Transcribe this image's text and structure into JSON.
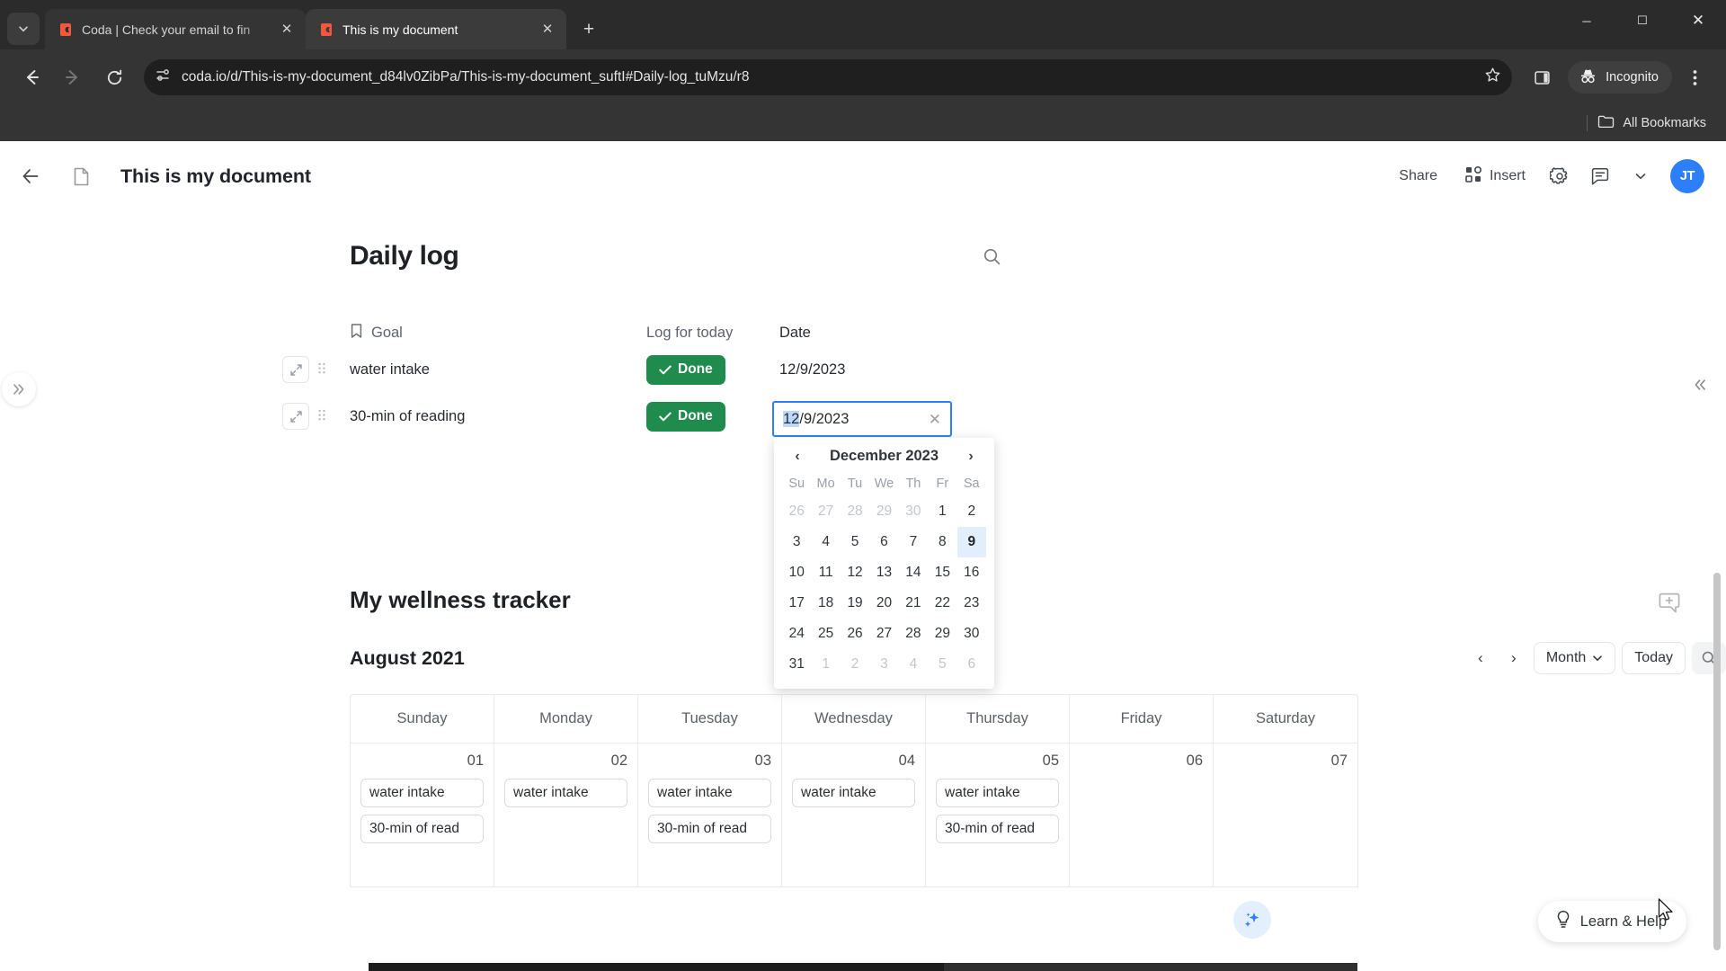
{
  "browser": {
    "tabs": [
      {
        "title": "Coda | Check your email to fin",
        "favicon": "coda-icon",
        "active": false
      },
      {
        "title": "This is my document",
        "favicon": "coda-icon",
        "active": true
      }
    ],
    "new_tab_label": "+",
    "tab_list_icon": "chevron-down-icon",
    "window_controls": {
      "minimize": "─",
      "maximize": "☐",
      "close": "✕"
    },
    "nav": {
      "back": "back-arrow-icon",
      "forward": "forward-arrow-icon",
      "reload": "reload-icon"
    },
    "omnibox": {
      "site_info_icon": "page-info-icon",
      "url": "coda.io/d/This-is-my-document_d84lv0ZibPa/This-is-my-document_suftI#Daily-log_tuMzu/r8",
      "bookmark_icon": "star-icon"
    },
    "side_panel_icon": "side-panel-icon",
    "incognito_label": "Incognito",
    "menu_icon": "three-dot-menu-icon",
    "bookmarks": {
      "all_bookmarks_label": "All Bookmarks"
    }
  },
  "doc": {
    "back_icon": "back-arrow-icon",
    "doc_icon": "document-icon",
    "title": "This is my document",
    "actions": {
      "share": "Share",
      "insert": "Insert",
      "settings_icon": "gear-icon",
      "comments_icon": "comment-icon",
      "chevron_icon": "chevron-down-icon"
    },
    "avatar_initials": "JT",
    "expand_left_icon": "double-chevron-right-icon",
    "collapse_right_icon": "double-chevron-left-icon",
    "add_comment_icon": "add-comment-icon"
  },
  "daily_log": {
    "title": "Daily log",
    "search_icon": "search-icon",
    "columns": [
      "Goal",
      "Log for today",
      "Date"
    ],
    "goal_column_icon": "bookmark-icon",
    "rows": [
      {
        "goal": "water intake",
        "log": "Done",
        "date": "12/9/2023",
        "editing": false
      },
      {
        "goal": "30-min of reading",
        "log": "Done",
        "date": "12/9/2023",
        "editing": true
      }
    ],
    "done_color": "#1f8c4d",
    "editor": {
      "value_selected": "12",
      "value_rest": "/9/2023",
      "clear_icon": "close-icon"
    }
  },
  "datepicker": {
    "prev_icon": "‹",
    "next_icon": "›",
    "month_label": "December 2023",
    "dow": [
      "Su",
      "Mo",
      "Tu",
      "We",
      "Th",
      "Fr",
      "Sa"
    ],
    "weeks": [
      [
        {
          "d": "26",
          "muted": true
        },
        {
          "d": "27",
          "muted": true
        },
        {
          "d": "28",
          "muted": true
        },
        {
          "d": "29",
          "muted": true
        },
        {
          "d": "30",
          "muted": true
        },
        {
          "d": "1"
        },
        {
          "d": "2"
        }
      ],
      [
        {
          "d": "3"
        },
        {
          "d": "4"
        },
        {
          "d": "5"
        },
        {
          "d": "6"
        },
        {
          "d": "7"
        },
        {
          "d": "8"
        },
        {
          "d": "9",
          "selected": true
        }
      ],
      [
        {
          "d": "10"
        },
        {
          "d": "11"
        },
        {
          "d": "12"
        },
        {
          "d": "13"
        },
        {
          "d": "14"
        },
        {
          "d": "15"
        },
        {
          "d": "16"
        }
      ],
      [
        {
          "d": "17"
        },
        {
          "d": "18"
        },
        {
          "d": "19"
        },
        {
          "d": "20"
        },
        {
          "d": "21"
        },
        {
          "d": "22"
        },
        {
          "d": "23"
        }
      ],
      [
        {
          "d": "24"
        },
        {
          "d": "25"
        },
        {
          "d": "26"
        },
        {
          "d": "27"
        },
        {
          "d": "28"
        },
        {
          "d": "29"
        },
        {
          "d": "30"
        }
      ],
      [
        {
          "d": "31"
        },
        {
          "d": "1",
          "muted": true
        },
        {
          "d": "2",
          "muted": true
        },
        {
          "d": "3",
          "muted": true
        },
        {
          "d": "4",
          "muted": true
        },
        {
          "d": "5",
          "muted": true
        },
        {
          "d": "6",
          "muted": true
        }
      ]
    ],
    "selected_bg": "#e3eefc"
  },
  "wellness": {
    "title": "My wellness tracker",
    "month_label": "August 2021",
    "prev_icon": "‹",
    "next_icon": "›",
    "view_label": "Month",
    "view_chevron": "chevron-down-icon",
    "today_label": "Today",
    "search_icon": "search-icon",
    "day_headers": [
      "Sunday",
      "Monday",
      "Tuesday",
      "Wednesday",
      "Thursday",
      "Friday",
      "Saturday"
    ],
    "week": [
      {
        "day": "01",
        "events": [
          "water intake",
          "30-min of read"
        ]
      },
      {
        "day": "02",
        "events": [
          "water intake"
        ]
      },
      {
        "day": "03",
        "events": [
          "water intake",
          "30-min of read"
        ]
      },
      {
        "day": "04",
        "events": [
          "water intake"
        ]
      },
      {
        "day": "05",
        "events": [
          "water intake",
          "30-min of read"
        ]
      },
      {
        "day": "06",
        "events": []
      },
      {
        "day": "07",
        "events": []
      }
    ]
  },
  "floating": {
    "ai_icon": "sparkles-icon",
    "learn_help_icon": "lightbulb-icon",
    "learn_help_label": "Learn & Help"
  }
}
